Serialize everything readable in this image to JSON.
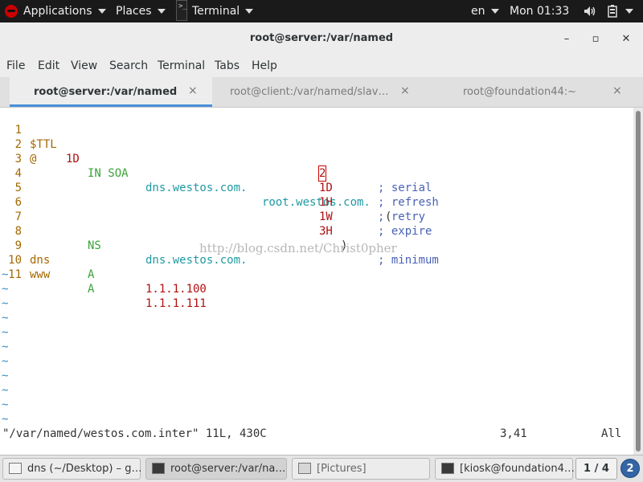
{
  "topbar": {
    "applications_label": "Applications",
    "places_label": "Places",
    "terminal_label": "Terminal",
    "lang": "en",
    "clock": "Mon 01:33",
    "terminal_icon_glyph": ">_"
  },
  "window": {
    "title": "root@server:/var/named",
    "minimize_glyph": "–",
    "maximize_glyph": "▫",
    "close_glyph": "✕"
  },
  "menubar": {
    "items": [
      "File",
      "Edit",
      "View",
      "Search",
      "Terminal",
      "Tabs",
      "Help"
    ]
  },
  "tabs": [
    {
      "label": "root@server:/var/named",
      "active": true
    },
    {
      "label": "root@client:/var/named/slav…",
      "active": false
    },
    {
      "label": "root@foundation44:~",
      "active": false
    }
  ],
  "tab_close_glyph": "×",
  "editor": {
    "lines": [
      {
        "n": "1",
        "a": "$TTL",
        "b": "1D"
      },
      {
        "n": "2",
        "a": "@",
        "b": "IN SOA",
        "c": "dns.westos.com.",
        "d": "root.westos.com.",
        "e": "("
      },
      {
        "n": "3",
        "val": "2",
        "cmt": "; serial"
      },
      {
        "n": "4",
        "val": "1D",
        "cmt": "; refresh"
      },
      {
        "n": "5",
        "val": "1H",
        "cmt": "; retry"
      },
      {
        "n": "6",
        "val": "1W",
        "cmt": "; expire"
      },
      {
        "n": "7",
        "val": "3H",
        "paren": ")",
        "cmt": "; minimum"
      },
      {
        "n": "8",
        "type": "NS",
        "target": "dns.westos.com."
      },
      {
        "n": "9",
        "name": "dns",
        "type": "A",
        "target": "1.1.1.100"
      },
      {
        "n": "10",
        "name": "www",
        "type": "A",
        "target": "1.1.1.111"
      },
      {
        "n": "11"
      }
    ],
    "tilde": "~",
    "status_file": "\"/var/named/westos.com.inter\" 11L, 430C",
    "status_pos": "3,41",
    "status_all": "All",
    "watermark": "http://blog.csdn.net/Christ0pher"
  },
  "taskbar": {
    "tasks": [
      {
        "label": "dns (~/Desktop) – g…"
      },
      {
        "label": "root@server:/var/na…"
      },
      {
        "label": "[Pictures]"
      },
      {
        "label": "[kiosk@foundation4…"
      }
    ],
    "pager": "1 / 4",
    "notifications": "2"
  },
  "colors": {
    "topbar_bg": "#1a1a1a",
    "tab_accent": "#4a90d9",
    "line_number": "#a36800",
    "keyword_green": "#3aa23a",
    "domain_cyan": "#1f9aa3",
    "number_red": "#b01010",
    "comment_blue": "#4a62b8",
    "tilde_blue": "#3a8cc0"
  }
}
